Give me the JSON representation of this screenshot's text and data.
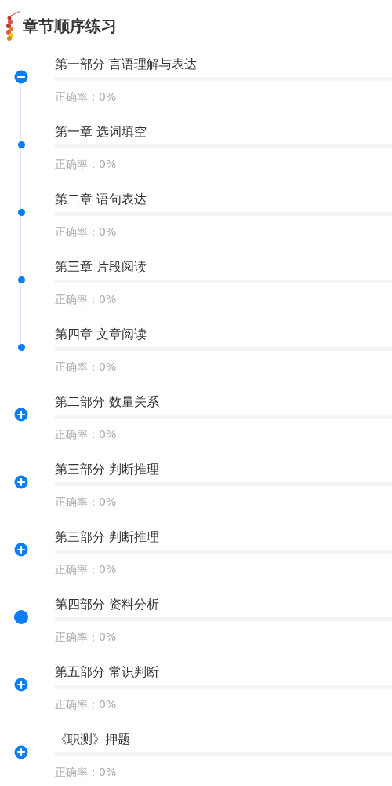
{
  "header": {
    "title": "章节顺序练习"
  },
  "sections": [
    {
      "kind": "group",
      "title": "第一部分 言语理解与表达",
      "expanded": true,
      "accuracy": "正确率：0%",
      "children": [
        {
          "title": "第一章 选词填空",
          "accuracy": "正确率：0%"
        },
        {
          "title": "第二章 语句表达",
          "accuracy": "正确率：0%"
        },
        {
          "title": "第三章 片段阅读",
          "accuracy": "正确率：0%"
        },
        {
          "title": "第四章 文章阅读",
          "accuracy": "正确率：0%"
        }
      ]
    },
    {
      "kind": "group",
      "title": "第二部分 数量关系",
      "expanded": false,
      "accuracy": "正确率：0%"
    },
    {
      "kind": "group",
      "title": "第三部分 判断推理",
      "expanded": false,
      "accuracy": "正确率：0%"
    },
    {
      "kind": "group",
      "title": "第三部分 判断推理",
      "expanded": false,
      "accuracy": "正确率：0%"
    },
    {
      "kind": "plain",
      "title": "第四部分 资料分析",
      "accuracy": "正确率：0%"
    },
    {
      "kind": "group",
      "title": "第五部分 常识判断",
      "expanded": false,
      "accuracy": "正确率：0%"
    },
    {
      "kind": "group",
      "title": "《职测》押题",
      "expanded": false,
      "accuracy": "正确率：0%"
    }
  ]
}
